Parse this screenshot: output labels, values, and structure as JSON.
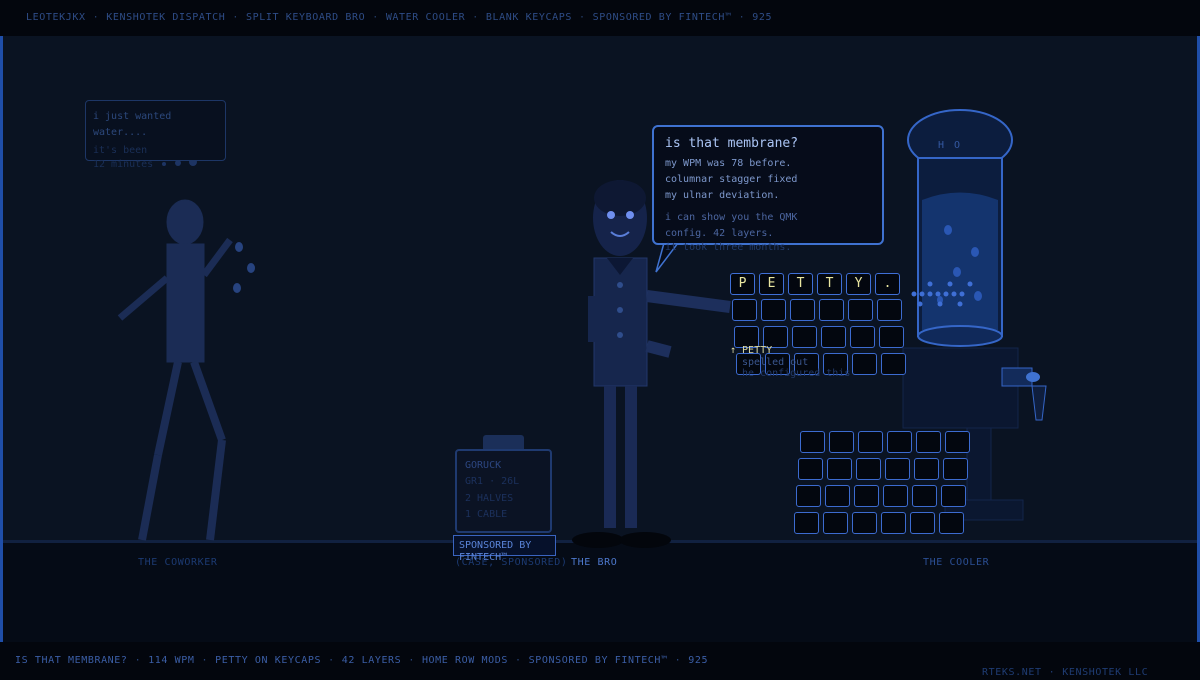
{
  "topbar": {
    "crumbs": [
      "LEOTEKJKX",
      "KENSHOTEK DISPATCH",
      "SPLIT KEYBOARD BRO",
      "WATER COOLER",
      "BLANK KEYCAPS",
      "SPONSORED BY FINTECH™"
    ],
    "number": "925"
  },
  "bro_bubble": {
    "question": "is that membrane?",
    "lines": [
      "my WPM was 78 before.",
      "columnar stagger fixed",
      "my ulnar deviation."
    ],
    "lines2": [
      "i can show you the QMK",
      "config. 42 layers.",
      "it took three months."
    ]
  },
  "coworker_bubble": {
    "lines": [
      "i just wanted",
      "water...."
    ],
    "faint_lines": [
      "it's been",
      "12 minutes"
    ]
  },
  "keyboard": {
    "petty_keys": [
      "P",
      "E",
      "T",
      "T",
      "Y",
      "."
    ],
    "petty_label": "↑ PETTY",
    "petty_sub": [
      "spelled out",
      "he configured this"
    ]
  },
  "jar": {
    "lines": [
      "GORUCK"
    ],
    "faint_lines": [
      "GR1 · 26L",
      "2 HALVES",
      "1 CABLE"
    ],
    "sponsor": "SPONSORED BY FINTECH™",
    "overlap_caption": "(CASE, SPONSORED)"
  },
  "cooler": {
    "label": "H O"
  },
  "captions": {
    "coworker": "THE COWORKER",
    "bro": "THE BRO",
    "cooler": "THE COOLER"
  },
  "ticker": [
    "IS THAT MEMBRANE?",
    "114 WPM",
    "PETTY ON KEYCAPS",
    "42 LAYERS",
    "HOME ROW MODS",
    "SPONSORED BY FINTECH™",
    "925"
  ],
  "credit": [
    "RTEKS.NET",
    "KENSHOTEK LLC"
  ],
  "colors": {
    "accent": "#3f72d0",
    "keycap_text": "#e9e6a0",
    "background": "#0a1322"
  }
}
